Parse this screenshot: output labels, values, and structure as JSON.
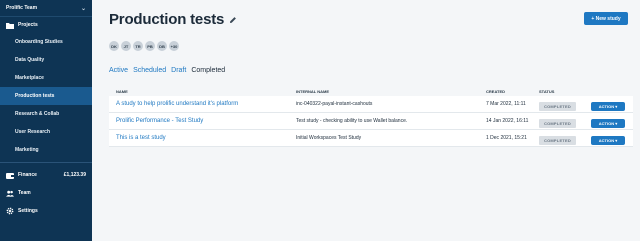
{
  "sidebar": {
    "team_name": "Prolific Team",
    "chevron_icon": "chevron-down",
    "projects_label": "Projects",
    "projects_icon": "folder",
    "items": [
      {
        "label": "Onboarding Studies",
        "active": false
      },
      {
        "label": "Data Quality",
        "active": false
      },
      {
        "label": "Marketplace",
        "active": false
      },
      {
        "label": "Production tests",
        "active": true
      },
      {
        "label": "Research & Collab",
        "active": false
      },
      {
        "label": "User Research",
        "active": false
      },
      {
        "label": "Marketing",
        "active": false
      }
    ],
    "finance": {
      "label": "Finance",
      "amount": "£1,123.39",
      "icon": "wallet"
    },
    "team": {
      "label": "Team",
      "icon": "users"
    },
    "settings": {
      "label": "Settings",
      "icon": "gear"
    },
    "colors": {
      "background": "#0e3454",
      "active": "#1a5a8f"
    }
  },
  "header": {
    "title": "Production tests",
    "edit_icon": "pencil",
    "new_study_label": "+ New study",
    "accent": "#1e78c2"
  },
  "avatars": [
    "DK",
    "JT",
    "TR",
    "PB",
    "DB",
    "+30"
  ],
  "tabs": [
    {
      "label": "Active",
      "active": false
    },
    {
      "label": "Scheduled",
      "active": false
    },
    {
      "label": "Draft",
      "active": false
    },
    {
      "label": "Completed",
      "active": true
    }
  ],
  "table": {
    "headers": [
      "NAME",
      "INTERNAL NAME",
      "CREATED",
      "STATUS"
    ],
    "rows": [
      {
        "name": "A study to help prolific understand it's platform",
        "internal": "inc-040322-payal-instant-cashouts",
        "created": "7 Mar 2022, 11:11",
        "status": "COMPLETED",
        "action": "ACTION ▾"
      },
      {
        "name": "Prolific Performance - Test Study",
        "internal": "Test study - checking ability to use Wallet balance.",
        "created": "14 Jan 2022, 16:11",
        "status": "COMPLETED",
        "action": "ACTION ▾"
      },
      {
        "name": "This is a test study",
        "internal": "Initial Workspaces Test Study",
        "created": "1 Dec 2021, 15:21",
        "status": "COMPLETED",
        "action": "ACTION ▾"
      }
    ]
  }
}
